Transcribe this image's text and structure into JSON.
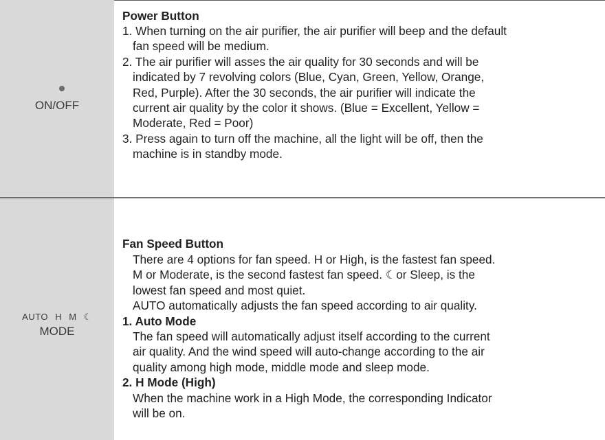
{
  "rows": [
    {
      "button_label": "ON/OFF",
      "title": "Power Button",
      "items": [
        [
          "1. When turning on the air purifier, the air purifier will beep and the default",
          "fan speed will be medium."
        ],
        [
          "2. The air purifier will asses the air quality for 30 seconds and will be",
          "indicated by 7 revolving colors (Blue, Cyan, Green, Yellow, Orange,",
          "Red, Purple). After the 30 seconds, the air purifier will indicate the",
          "current air quality by the color it shows. (Blue = Excellent, Yellow =",
          "Moderate, Red = Poor)"
        ],
        [
          "3. Press again to turn off the machine, all the light will be off, then the",
          "machine is in standby mode."
        ]
      ]
    },
    {
      "mode_indicators": [
        "AUTO",
        "H",
        "M",
        "☾"
      ],
      "button_label": "MODE",
      "title": "Fan Speed Button",
      "intro": [
        "There are 4 options for fan speed. H or High, is the fastest fan speed.",
        "M or Moderate, is the second fastest fan speed. ☾or Sleep, is the",
        "lowest fan speed and most quiet.",
        "AUTO automatically adjusts the fan speed according to air quality."
      ],
      "sections": [
        {
          "heading": "1. Auto Mode",
          "lines": [
            "The fan speed will automatically adjust itself according to the current",
            "air quality. And the wind speed will auto-change according to the air",
            "quality among high mode, middle mode and sleep mode."
          ]
        },
        {
          "heading": "2. H Mode (High)",
          "lines": [
            "When the machine work in a High Mode, the corresponding Indicator",
            "will be on."
          ]
        }
      ]
    }
  ]
}
